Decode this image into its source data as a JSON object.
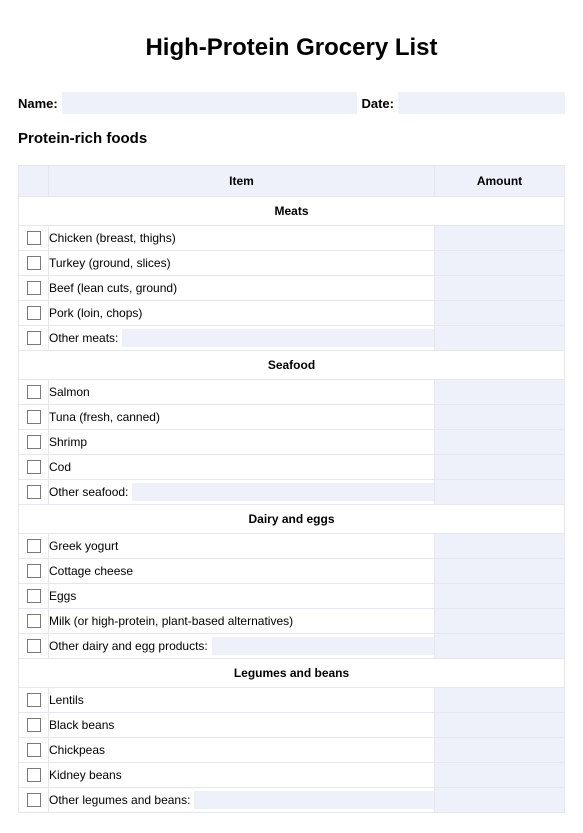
{
  "title": "High-Protein Grocery List",
  "meta": {
    "name_label": "Name:",
    "date_label": "Date:"
  },
  "section_title": "Protein-rich foods",
  "table": {
    "col_item": "Item",
    "col_amount": "Amount"
  },
  "categories": [
    {
      "name": "Meats",
      "items": [
        "Chicken (breast, thighs)",
        "Turkey (ground, slices)",
        "Beef (lean cuts, ground)",
        "Pork (loin, chops)"
      ],
      "other_label": "Other meats:"
    },
    {
      "name": "Seafood",
      "items": [
        "Salmon",
        "Tuna (fresh, canned)",
        "Shrimp",
        "Cod"
      ],
      "other_label": "Other seafood:"
    },
    {
      "name": "Dairy and eggs",
      "items": [
        "Greek yogurt",
        "Cottage cheese",
        "Eggs",
        "Milk (or high-protein, plant-based alternatives)"
      ],
      "other_label": "Other dairy and egg products:"
    },
    {
      "name": "Legumes and beans",
      "items": [
        "Lentils",
        "Black beans",
        "Chickpeas",
        "Kidney beans"
      ],
      "other_label": "Other legumes and beans:"
    }
  ]
}
